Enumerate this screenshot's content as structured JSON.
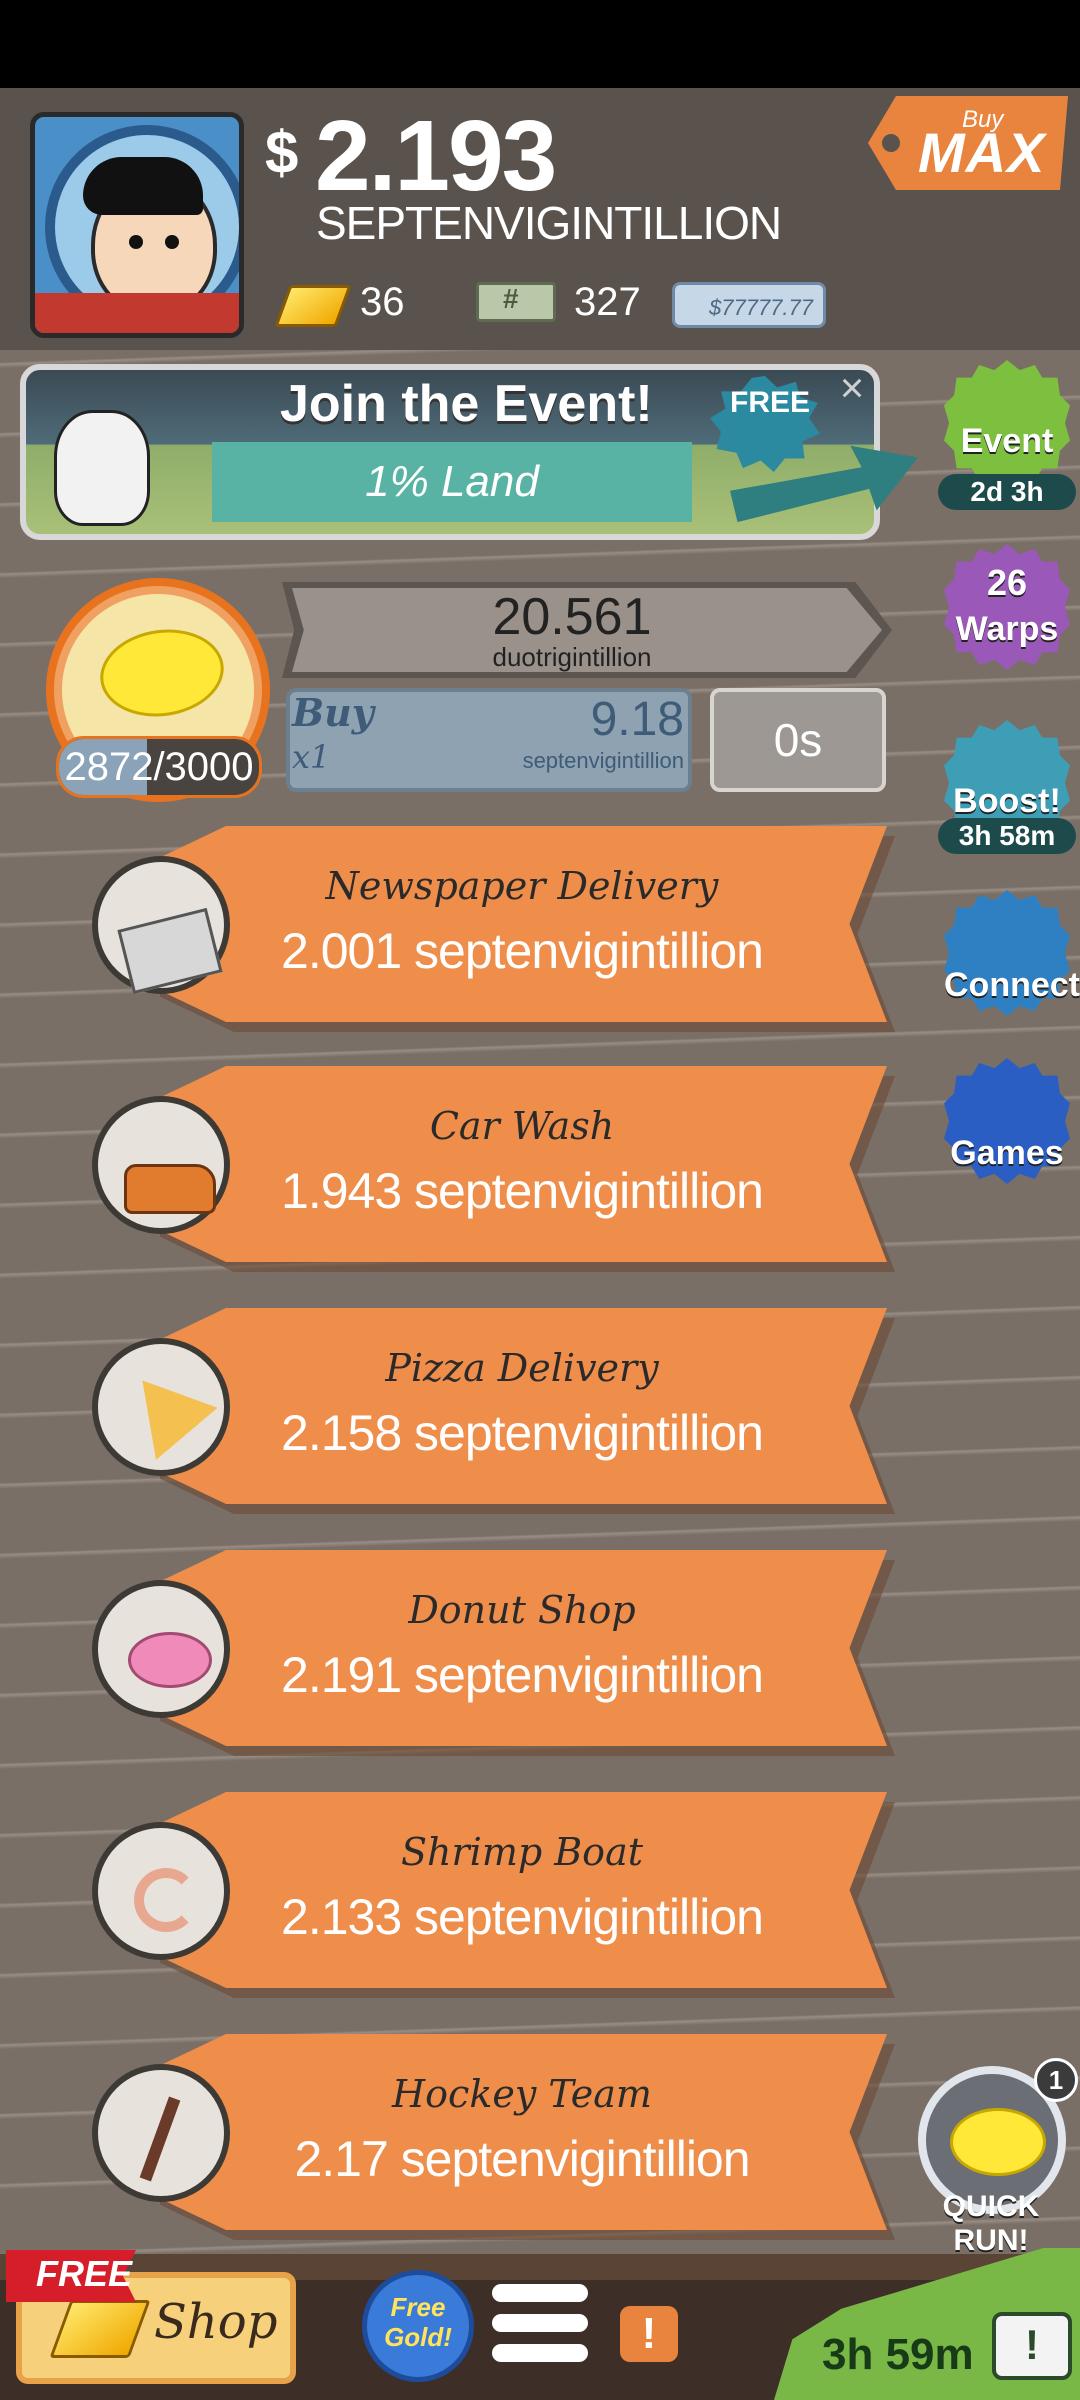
{
  "header": {
    "currency_symbol": "$",
    "money_value": "2.193",
    "money_unit": "SEPTENVIGINTILLION",
    "gold_count": "36",
    "bills_count": "327",
    "mega_bucks": "$77777.77",
    "buy_max_small": "Buy",
    "buy_max_big": "MAX"
  },
  "event_banner": {
    "title": "Join the Event!",
    "subtitle": "1% Land",
    "free_label": "FREE",
    "close_icon": "×"
  },
  "side_buttons": [
    {
      "label": "Event",
      "timer": "2d 3h",
      "color": "#7dbf3f"
    },
    {
      "label": "Warps",
      "count": "26",
      "color": "#9a59b8"
    },
    {
      "label": "Boost!",
      "timer": "3h 58m",
      "color": "#3d9eb6"
    },
    {
      "label": "Connect",
      "color": "#2f80c2"
    },
    {
      "label": "Games",
      "color": "#2a5ec2"
    }
  ],
  "manager": {
    "progress_current": 2872,
    "progress_max": 3000,
    "progress_text_current": "2872",
    "progress_text_sep": "/3000",
    "revenue_value": "20.561",
    "revenue_unit": "duotrigintillion",
    "buy_label": "Buy",
    "buy_qty": "x1",
    "buy_price": "9.18",
    "buy_unit": "septenvigintillion",
    "timer": "0s"
  },
  "businesses": [
    {
      "name": "Newspaper Delivery",
      "value": "2.001 septenvigintillion",
      "icon": "newspaper-icon"
    },
    {
      "name": "Car Wash",
      "value": "1.943 septenvigintillion",
      "icon": "car-icon"
    },
    {
      "name": "Pizza Delivery",
      "value": "2.158 septenvigintillion",
      "icon": "pizza-icon"
    },
    {
      "name": "Donut Shop",
      "value": "2.191 septenvigintillion",
      "icon": "donut-icon"
    },
    {
      "name": "Shrimp Boat",
      "value": "2.133 septenvigintillion",
      "icon": "shrimp-icon"
    },
    {
      "name": "Hockey Team",
      "value": "2.17 septenvigintillion",
      "icon": "hockey-icon"
    }
  ],
  "quick_run": {
    "label": "QUICK RUN!",
    "badge": "1"
  },
  "bottom_bar": {
    "free_label": "FREE",
    "shop_label": "Shop",
    "free_gold_label": "Free Gold!",
    "alert": "!",
    "tv_timer": "3h 59m",
    "tv_icon": "!"
  }
}
